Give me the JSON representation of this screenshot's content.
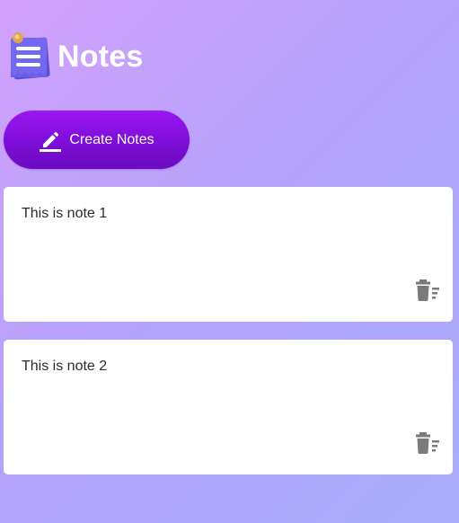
{
  "app": {
    "title": "Notes",
    "logo_icon": "notepad-logo-icon"
  },
  "toolbar": {
    "create_label": "Create Notes",
    "create_icon": "pencil-icon"
  },
  "notes": [
    {
      "text": "This is note 1",
      "delete_icon": "delete-icon"
    },
    {
      "text": "This is note 2",
      "delete_icon": "delete-icon"
    }
  ],
  "colors": {
    "background_start": "#d2a1fc",
    "background_end": "#a8acfb",
    "button_start": "#9a17f2",
    "button_end": "#6a0bbf",
    "card": "#ffffff",
    "delete_icon": "#7a7a7a"
  }
}
